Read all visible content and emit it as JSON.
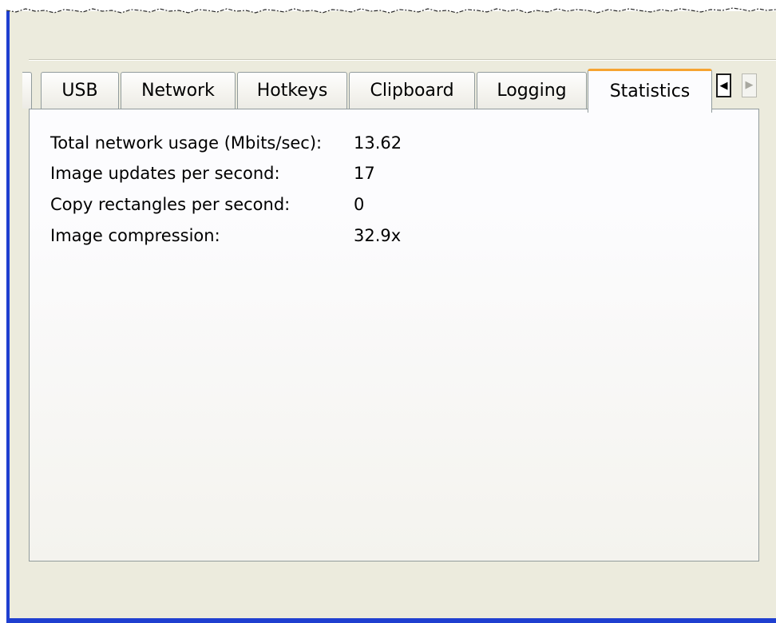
{
  "tabs": {
    "items": [
      {
        "label": "USB"
      },
      {
        "label": "Network"
      },
      {
        "label": "Hotkeys"
      },
      {
        "label": "Clipboard"
      },
      {
        "label": "Logging"
      },
      {
        "label": "Statistics"
      }
    ],
    "selected": "Statistics",
    "scroll_left_icon": "triangle-left",
    "scroll_right_icon": "triangle-right"
  },
  "statistics": {
    "rows": [
      {
        "label": "Total network usage (Mbits/sec):",
        "value": "13.62"
      },
      {
        "label": "Image updates per second:",
        "value": "17"
      },
      {
        "label": "Copy rectangles per second:",
        "value": "0"
      },
      {
        "label": "Image compression:",
        "value": "32.9x"
      }
    ]
  },
  "colors": {
    "window_border": "#1f3fd0",
    "dialog_background": "#ecebdd",
    "selected_tab_accent": "#f6a431"
  }
}
